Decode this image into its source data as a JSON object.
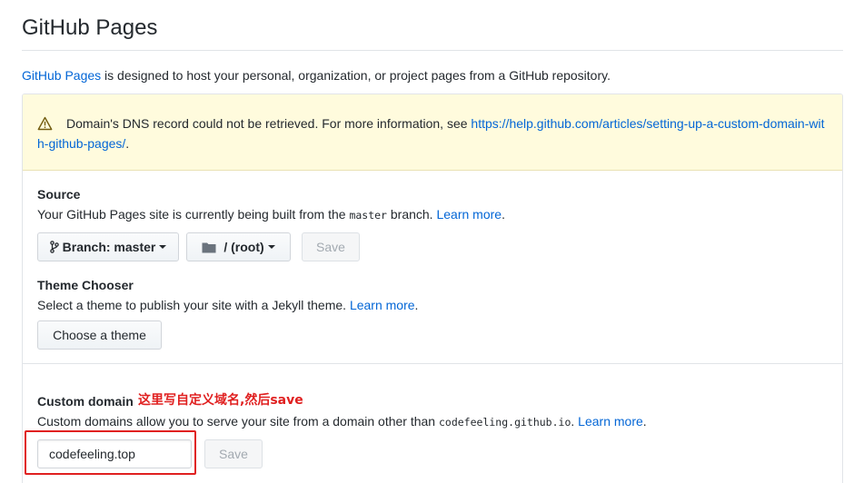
{
  "header": {
    "title": "GitHub Pages"
  },
  "intro": {
    "link_text": "GitHub Pages",
    "text": " is designed to host your personal, organization, or project pages from a GitHub repository."
  },
  "warning": {
    "icon": "alert-icon",
    "text": "Domain's DNS record could not be retrieved. For more information, see ",
    "link": "https://help.github.com/articles/setting-up-a-custom-domain-with-github-pages/",
    "after_link": "."
  },
  "source": {
    "title": "Source",
    "desc_before": "Your GitHub Pages site is currently being built from the ",
    "branch_code": "master",
    "desc_after": " branch. ",
    "learn_more": "Learn more",
    "period": ".",
    "branch_button": "Branch: master",
    "folder_button": "/ (root)",
    "save_button": "Save"
  },
  "theme": {
    "title": "Theme Chooser",
    "desc": "Select a theme to publish your site with a Jekyll theme. ",
    "learn_more": "Learn more",
    "period": ".",
    "button": "Choose a theme"
  },
  "custom_domain": {
    "title": "Custom domain",
    "annotation": "这里写自定义域名,然后save",
    "desc_before": "Custom domains allow you to serve your site from a domain other than ",
    "domain_code": "codefeeling.github.io",
    "desc_after": ". ",
    "learn_more": "Learn more",
    "period": ".",
    "input_value": "codefeeling.top",
    "save_button": "Save"
  },
  "colors": {
    "link": "#0366d6",
    "warning_bg": "#fffbdd",
    "annotation": "#e02020"
  }
}
